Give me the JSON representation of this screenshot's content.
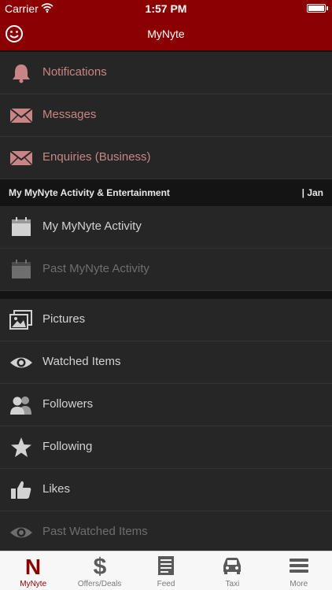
{
  "status_bar": {
    "carrier": "Carrier",
    "time": "1:57 PM"
  },
  "nav_bar": {
    "title": "MyNyte",
    "left_icon": "smiley-icon"
  },
  "group_top": [
    {
      "label": "Notifications",
      "icon": "bell-icon"
    },
    {
      "label": "Messages",
      "icon": "envelope-icon"
    },
    {
      "label": "Enquiries (Business)",
      "icon": "envelope-icon"
    }
  ],
  "section_header": {
    "title": "My MyNyte Activity & Entertainment",
    "right": "|  Jan"
  },
  "group_activity": [
    {
      "label": "My MyNyte Activity",
      "icon": "calendar-icon"
    },
    {
      "label": "Past MyNyte Activity",
      "icon": "calendar-icon"
    }
  ],
  "group_bottom": [
    {
      "label": "Pictures",
      "icon": "pictures-icon"
    },
    {
      "label": "Watched Items",
      "icon": "eye-icon"
    },
    {
      "label": "Followers",
      "icon": "followers-icon"
    },
    {
      "label": "Following",
      "icon": "star-icon"
    },
    {
      "label": "Likes",
      "icon": "thumbs-up-icon"
    },
    {
      "label": "Past Watched Items",
      "icon": "eye-icon"
    }
  ],
  "tab_bar": {
    "active": "MyNyte",
    "tabs": [
      {
        "label": "MyNyte",
        "icon": "mynyte-logo-icon"
      },
      {
        "label": "Offers/Deals",
        "icon": "dollar-icon"
      },
      {
        "label": "Feed",
        "icon": "feed-icon"
      },
      {
        "label": "Taxi",
        "icon": "car-icon"
      },
      {
        "label": "More",
        "icon": "menu-icon"
      }
    ]
  },
  "colors": {
    "brand": "#8b0000",
    "background": "#262626",
    "section_header_bg": "#141414",
    "red_label": "#c98585",
    "white_label": "#d2d2d2",
    "dim_label": "#6e6e6e"
  }
}
